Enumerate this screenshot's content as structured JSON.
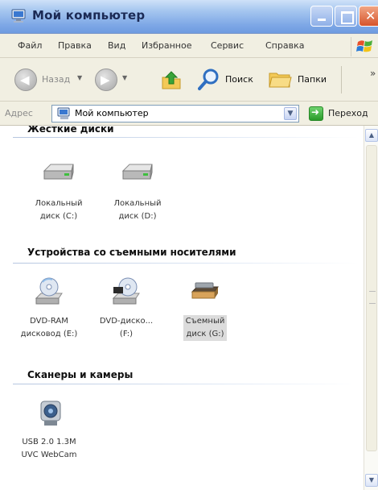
{
  "window": {
    "title": "Мой компьютер",
    "close_glyph": "✕"
  },
  "menu": {
    "items": [
      "Файл",
      "Правка",
      "Вид",
      "Избранное",
      "Сервис",
      "Справка"
    ]
  },
  "toolbar": {
    "back_label": "Назад",
    "search_label": "Поиск",
    "folders_label": "Папки",
    "more_glyph": "»"
  },
  "address": {
    "label": "Адрес",
    "value": "Мой компьютер",
    "go_label": "Переход"
  },
  "groups": [
    {
      "title": "Жесткие диски",
      "items": [
        {
          "label_line1": "Локальный",
          "label_line2": "диск (C:)",
          "icon": "hard-disk-icon"
        },
        {
          "label_line1": "Локальный",
          "label_line2": "диск (D:)",
          "icon": "hard-disk-icon"
        }
      ]
    },
    {
      "title": "Устройства со съемными носителями",
      "items": [
        {
          "label_line1": "DVD-RAM",
          "label_line2": "дисковод (E:)",
          "icon": "dvd-drive-icon"
        },
        {
          "label_line1": "DVD-диско...",
          "label_line2": "(F:)",
          "icon": "dvd-drive-icon"
        },
        {
          "label_line1": "Съемный",
          "label_line2": "диск (G:)",
          "icon": "removable-disk-icon",
          "selected": true
        }
      ]
    },
    {
      "title": "Сканеры и камеры",
      "items": [
        {
          "label_line1": "USB 2.0 1.3M",
          "label_line2": "UVC WebCam",
          "icon": "webcam-icon"
        }
      ]
    }
  ],
  "colors": {
    "titlebar": "#7ea8e6",
    "close_button": "#d6542b",
    "selection": "#dcdcdc",
    "go_button": "#2a9a2a"
  }
}
